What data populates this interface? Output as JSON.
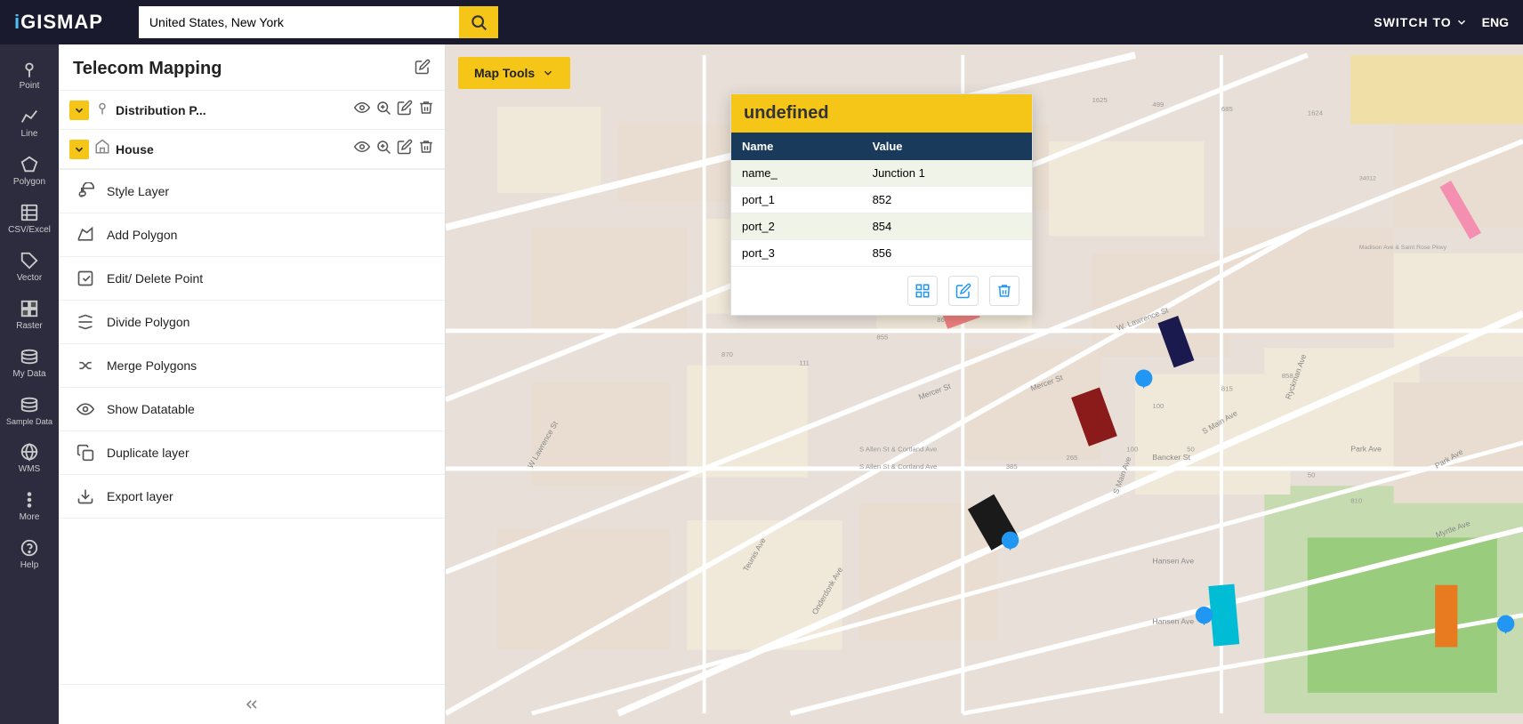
{
  "header": {
    "logo_prefix": "i",
    "logo_main": "GISMAP",
    "search_placeholder": "United States, New York",
    "search_value": "United States, New York",
    "switch_to_label": "SWITCH TO",
    "lang_label": "ENG"
  },
  "sidebar_icons": [
    {
      "id": "point",
      "label": "Point",
      "icon": "point"
    },
    {
      "id": "line",
      "label": "Line",
      "icon": "line"
    },
    {
      "id": "polygon",
      "label": "Polygon",
      "icon": "polygon"
    },
    {
      "id": "csv",
      "label": "CSV/Excel",
      "icon": "csv"
    },
    {
      "id": "vector",
      "label": "Vector",
      "icon": "vector"
    },
    {
      "id": "raster",
      "label": "Raster",
      "icon": "raster"
    },
    {
      "id": "mydata",
      "label": "My Data",
      "icon": "mydata"
    },
    {
      "id": "sampledata",
      "label": "Sample Data",
      "icon": "sampledata"
    },
    {
      "id": "wms",
      "label": "WMS",
      "icon": "wms"
    },
    {
      "id": "more",
      "label": "More",
      "icon": "more"
    },
    {
      "id": "help",
      "label": "Help",
      "icon": "help"
    }
  ],
  "layers_panel": {
    "title": "Telecom Mapping",
    "layers": [
      {
        "id": "distribution",
        "name": "Distribution P...",
        "icon": "pin",
        "expanded": true
      },
      {
        "id": "house",
        "name": "House",
        "icon": "polygon",
        "expanded": true
      }
    ]
  },
  "context_menu": {
    "items": [
      {
        "id": "style-layer",
        "label": "Style Layer",
        "icon": "brush"
      },
      {
        "id": "add-polygon",
        "label": "Add Polygon",
        "icon": "polygon"
      },
      {
        "id": "edit-delete-point",
        "label": "Edit/ Delete Point",
        "icon": "edit"
      },
      {
        "id": "divide-polygon",
        "label": "Divide Polygon",
        "icon": "divide"
      },
      {
        "id": "merge-polygons",
        "label": "Merge Polygons",
        "icon": "merge"
      },
      {
        "id": "show-datatable",
        "label": "Show Datatable",
        "icon": "eye"
      },
      {
        "id": "duplicate-layer",
        "label": "Duplicate layer",
        "icon": "duplicate"
      },
      {
        "id": "export-layer",
        "label": "Export layer",
        "icon": "export"
      }
    ]
  },
  "map": {
    "tools_btn": "Map Tools",
    "popup": {
      "title": "undefined",
      "table_headers": [
        "Name",
        "Value"
      ],
      "rows": [
        {
          "name": "name_",
          "value": "Junction 1"
        },
        {
          "name": "port_1",
          "value": "852"
        },
        {
          "name": "port_2",
          "value": "854"
        },
        {
          "name": "port_3",
          "value": "856"
        }
      ]
    }
  },
  "colors": {
    "accent_yellow": "#f5c518",
    "header_dark": "#1a1a2e",
    "table_header": "#1a3a5c",
    "row_odd": "#f0f4e8",
    "row_even": "#ffffff"
  }
}
